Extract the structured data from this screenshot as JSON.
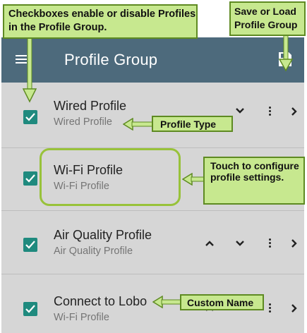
{
  "annotations": {
    "checkboxes_note": "Checkboxes enable or disable Profiles in the Profile Group.",
    "save_load_note": "Save or Load Profile Group",
    "profile_type_note": "Profile Type",
    "touch_note": "Touch to configure profile settings.",
    "custom_name_note": "Custom Name",
    "callout_color": "#c7e88f"
  },
  "toolbar": {
    "title": "Profile Group",
    "menu_icon": "hamburger-menu-icon",
    "save_icon": "save-icon",
    "background": "#4d6a7c"
  },
  "profiles": [
    {
      "name": "Wired Profile",
      "type": "Wired Profile",
      "checked": true,
      "controls": [
        "chevron-down",
        "more",
        "chevron-right"
      ]
    },
    {
      "name": "Wi-Fi Profile",
      "type": "Wi-Fi Profile",
      "checked": true,
      "controls": []
    },
    {
      "name": "Air Quality Profile",
      "type": "Air Quality Profile",
      "checked": true,
      "controls": [
        "chevron-up",
        "chevron-down",
        "more",
        "chevron-right"
      ]
    },
    {
      "name": "Connect to Lobo",
      "type": "Wi-Fi Profile",
      "checked": true,
      "controls": [
        "chevron-up",
        "more",
        "chevron-right"
      ]
    }
  ],
  "colors": {
    "checkbox": "#1f8a7e",
    "list_bg": "#d6d6d6"
  }
}
